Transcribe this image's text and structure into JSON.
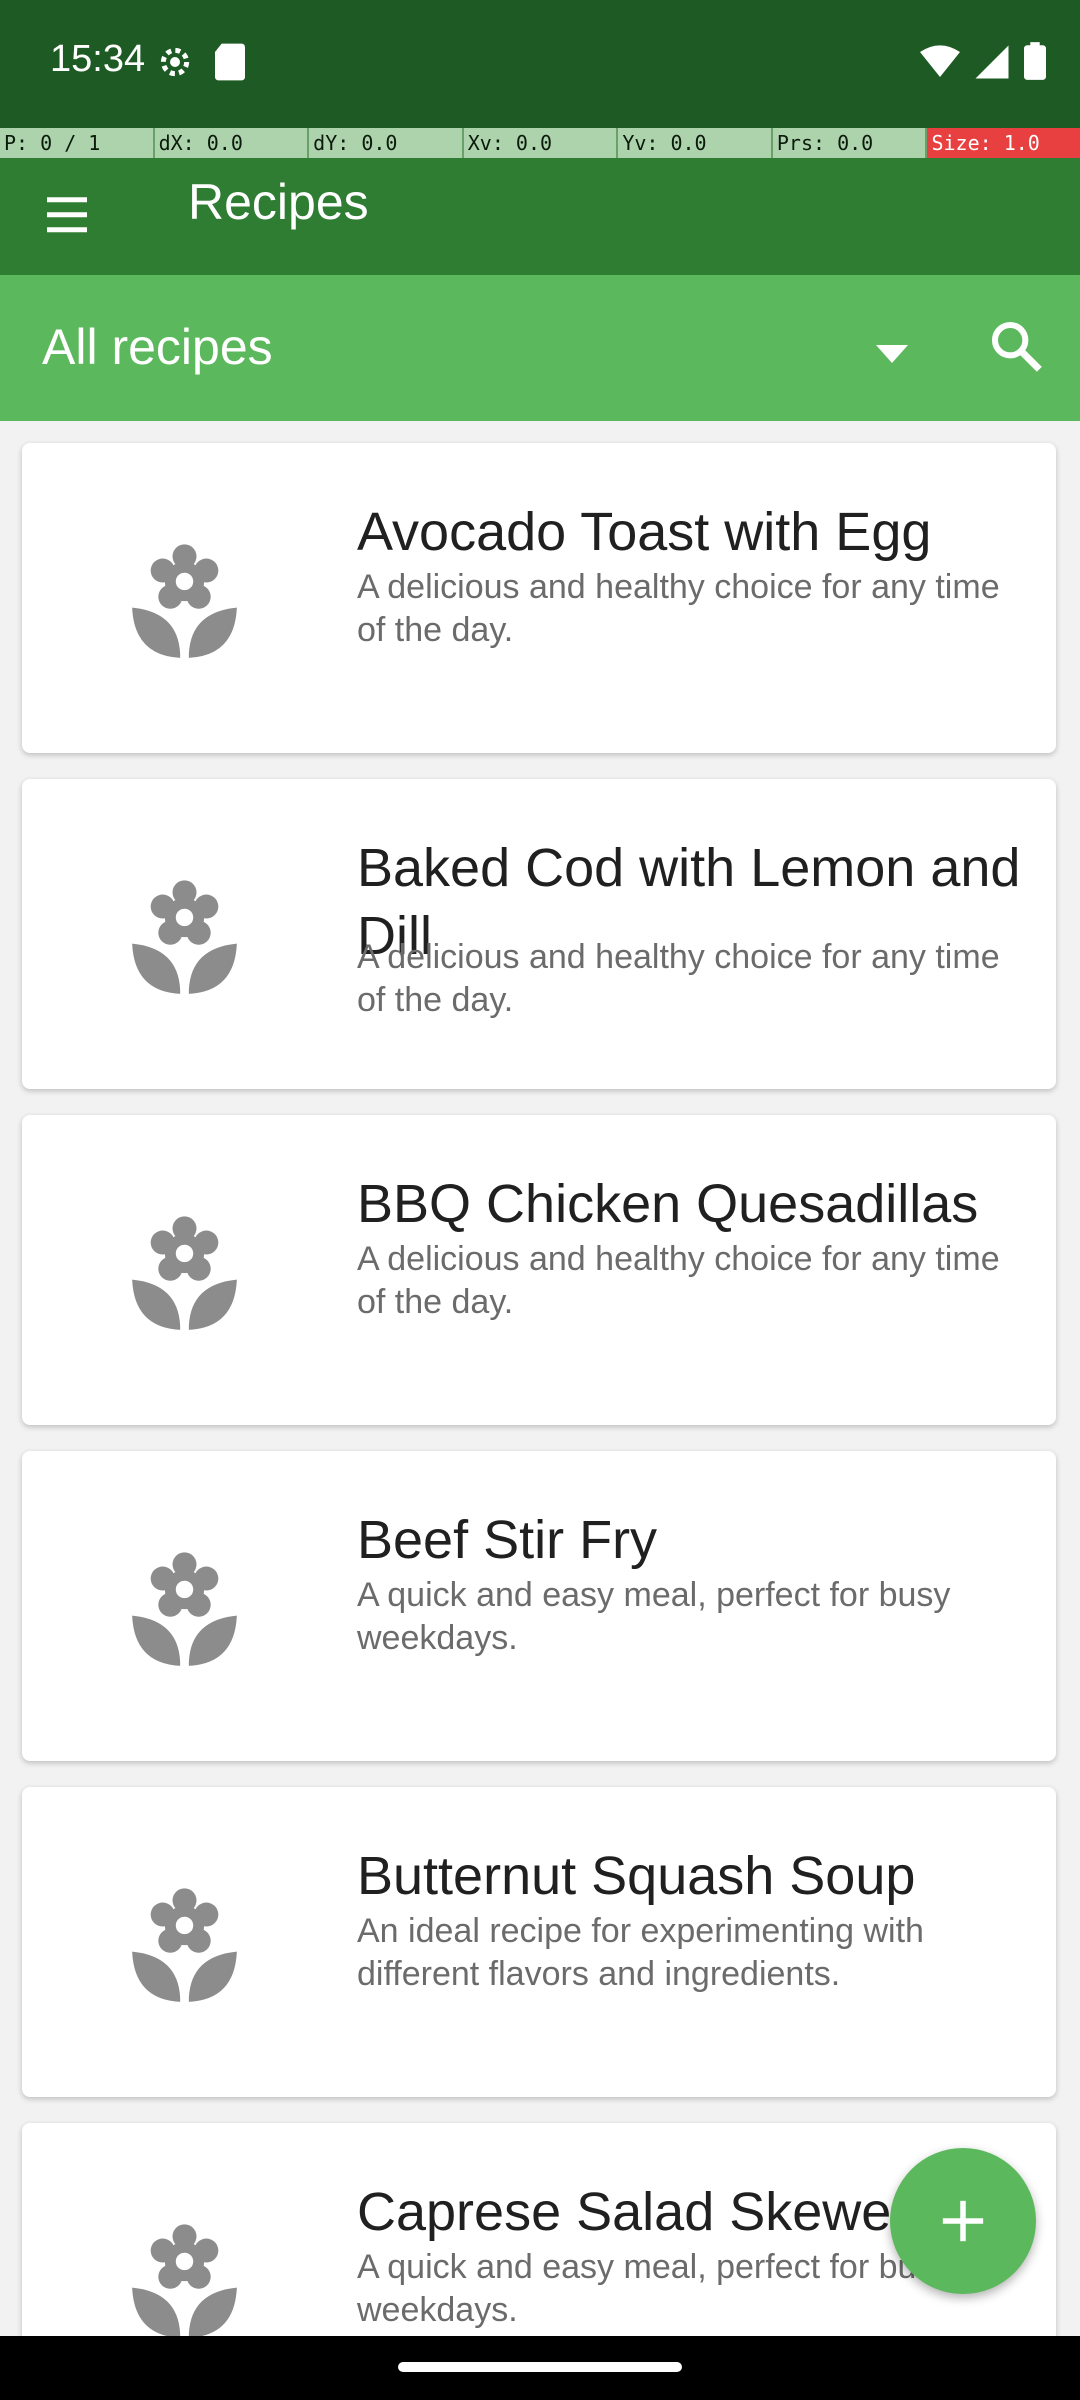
{
  "status": {
    "time": "15:34",
    "left_icons": [
      "settings-gear-icon",
      "sd-card-icon"
    ],
    "right_icons": [
      "wifi-icon",
      "signal-icon",
      "battery-icon"
    ]
  },
  "overlay": {
    "cells": [
      "P: 0 / 1",
      "dX: 0.0",
      "dY: 0.0",
      "Xv: 0.0",
      "Yv: 0.0",
      "Prs: 0.0",
      "Size: 1.0"
    ]
  },
  "appbar": {
    "title": "Recipes",
    "menu_icon": "hamburger-menu-icon"
  },
  "filter": {
    "selected": "All recipes",
    "dropdown_icon": "dropdown-arrow-icon",
    "search_icon": "search-icon"
  },
  "recipes": [
    {
      "title": "Avocado Toast with Egg",
      "subtitle": "A delicious and healthy choice for any time of the day."
    },
    {
      "title": "Baked Cod with Lemon and Dill",
      "subtitle": "A delicious and healthy choice for any time of the day."
    },
    {
      "title": "BBQ Chicken Quesadillas",
      "subtitle": "A delicious and healthy choice for any time of the day."
    },
    {
      "title": "Beef Stir Fry",
      "subtitle": "A quick and easy meal, perfect for busy weekdays."
    },
    {
      "title": "Butternut Squash Soup",
      "subtitle": "An ideal recipe for experimenting with different flavors and ingredients."
    },
    {
      "title": "Caprese Salad Skewers",
      "subtitle": "A quick and easy meal, perfect for busy weekdays."
    }
  ],
  "fab": {
    "icon": "add-icon"
  },
  "colors": {
    "status_bar": "#1e5a24",
    "app_bar": "#2e7d32",
    "filter_bar": "#5cb85c",
    "fab": "#5cb85c",
    "card_icon": "#8c8c8c"
  }
}
